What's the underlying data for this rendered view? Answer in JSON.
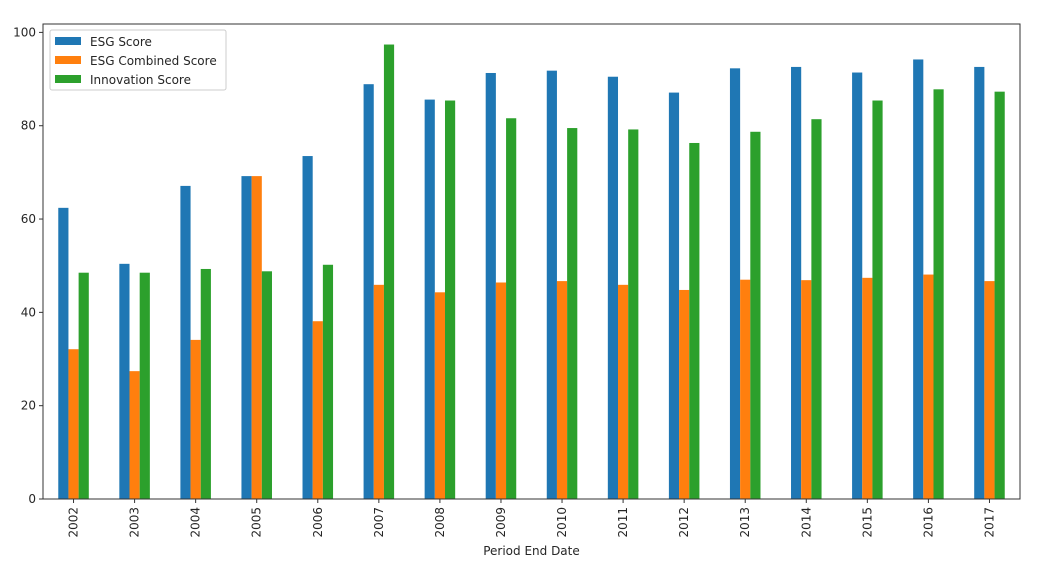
{
  "chart_data": {
    "type": "bar",
    "title": "",
    "xlabel": "Period End Date",
    "ylabel": "",
    "ylim": [
      0,
      101.8
    ],
    "yticks": [
      0,
      20,
      40,
      60,
      80,
      100
    ],
    "grid": false,
    "legend_position": "top-left",
    "categories": [
      "2002",
      "2003",
      "2004",
      "2005",
      "2006",
      "2007",
      "2008",
      "2009",
      "2010",
      "2011",
      "2012",
      "2013",
      "2014",
      "2015",
      "2016",
      "2017"
    ],
    "series": [
      {
        "name": "ESG Score",
        "color": "#1f77b4",
        "values": [
          62.4,
          50.4,
          67.1,
          69.2,
          73.5,
          88.9,
          85.6,
          91.3,
          91.8,
          90.5,
          87.1,
          92.3,
          92.6,
          91.4,
          94.2,
          92.6
        ]
      },
      {
        "name": "ESG Combined Score",
        "color": "#ff7f0e",
        "values": [
          32.1,
          27.4,
          34.1,
          69.2,
          38.1,
          45.9,
          44.3,
          46.4,
          46.7,
          45.9,
          44.8,
          47.0,
          46.9,
          47.4,
          48.1,
          46.7
        ]
      },
      {
        "name": "Innovation Score",
        "color": "#2ca02c",
        "values": [
          48.5,
          48.5,
          49.3,
          48.8,
          50.2,
          97.4,
          85.4,
          81.6,
          79.5,
          79.2,
          76.3,
          78.7,
          81.4,
          85.4,
          87.8,
          87.3
        ]
      }
    ]
  }
}
